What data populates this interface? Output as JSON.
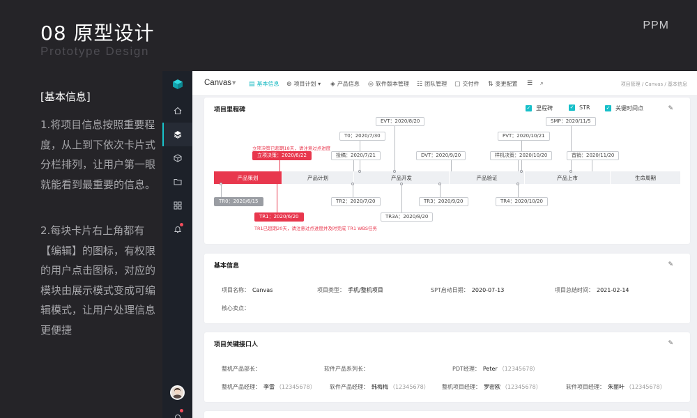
{
  "slide": {
    "title": "08  原型设计",
    "subtitle": "Prototype Design",
    "brand": "PPM",
    "section": "[基本信息]",
    "para1": "1.将项目信息按照重要程度，从上到下依次卡片式分栏排列，让用户第一眼就能看到最重要的信息。",
    "para2": "2.每块卡片右上角都有【编辑】的图标，有权限的用户点击图标，对应的模块由展示模式变成可编辑模式，让用户处理信息更便捷"
  },
  "rail": {
    "icons": [
      "cube-logo-icon",
      "home-icon",
      "layers-icon",
      "box-icon",
      "folder-icon",
      "grid-icon",
      "bell-icon"
    ]
  },
  "topbar": {
    "project": "Canvas",
    "tabs": [
      {
        "label": "基本信息",
        "icon": "▤"
      },
      {
        "label": "项目计划 ▾",
        "icon": "⊕"
      },
      {
        "label": "产品信息",
        "icon": "◈"
      },
      {
        "label": "软件版本管理",
        "icon": "◎"
      },
      {
        "label": "团队管理",
        "icon": "☷"
      },
      {
        "label": "交付件",
        "icon": "▢"
      },
      {
        "label": "变更配置",
        "icon": "⇅"
      },
      {
        "label": "",
        "icon": "☰"
      },
      {
        "label": "",
        "icon": "⌕"
      }
    ],
    "breadcrumb": "项目管理  /  Canvas  /  基本信息"
  },
  "milestone": {
    "title": "项目里程碑",
    "legend": [
      "里程碑",
      "STR",
      "关键时间点"
    ],
    "phases": [
      "产品策划",
      "产品计划",
      "产品开发",
      "产品验证",
      "产品上市",
      "生命周期"
    ],
    "top": [
      "立项决策：2020/6/22",
      "投稿：2020/7/21",
      "T0：2020/7/30",
      "EVT：2020/8/20",
      "DVT：2020/9/20",
      "样机决策：2020/10/20",
      "PVT：2020/10/21",
      "SMP：2020/11/5",
      "首销：2020/11/20"
    ],
    "bottom": [
      "TR0：2020/6/15",
      "TR1：2020/6/20",
      "TR2：2020/7/20",
      "TR3A：2020/8/20",
      "TR3：2020/9/20",
      "TR4：2020/10/20"
    ],
    "note_top": "立项决策已超期18天，请注意过点进度",
    "note_bottom": "TR1已超期20天，请注意过点进度并及时完成 TR1 WBS任务"
  },
  "basic": {
    "title": "基本信息",
    "fields": [
      {
        "k": "项目名称：",
        "v": "Canvas"
      },
      {
        "k": "项目类型：",
        "v": "手机/整机项目"
      },
      {
        "k": "SPT启动日期：",
        "v": "2020-07-13"
      },
      {
        "k": "项目总结时间：",
        "v": "2021-02-14"
      },
      {
        "k": "核心卖点：",
        "v": ""
      }
    ]
  },
  "contacts": {
    "title": "项目关键接口人",
    "row1": [
      {
        "k": "整机产品部长：",
        "v": "",
        "g": ""
      },
      {
        "k": "软件产品系列长：",
        "v": "",
        "g": ""
      },
      {
        "k": "PDT经理：",
        "v": "Peter",
        "g": "（12345678）"
      }
    ],
    "row2": [
      {
        "k": "整机产品经理：",
        "v": "李雷",
        "g": "（12345678）"
      },
      {
        "k": "软件产品经理：",
        "v": "韩梅梅",
        "g": "（12345678）"
      },
      {
        "k": "整机项目经理：",
        "v": "罗密欧",
        "g": "（12345678）"
      },
      {
        "k": "软件项目经理：",
        "v": "朱丽叶",
        "g": "（12345678）"
      }
    ]
  },
  "colors": {
    "accent": "#16bfc9",
    "danger": "#e8374d",
    "bg": "#252428",
    "rail": "#1d2129"
  }
}
